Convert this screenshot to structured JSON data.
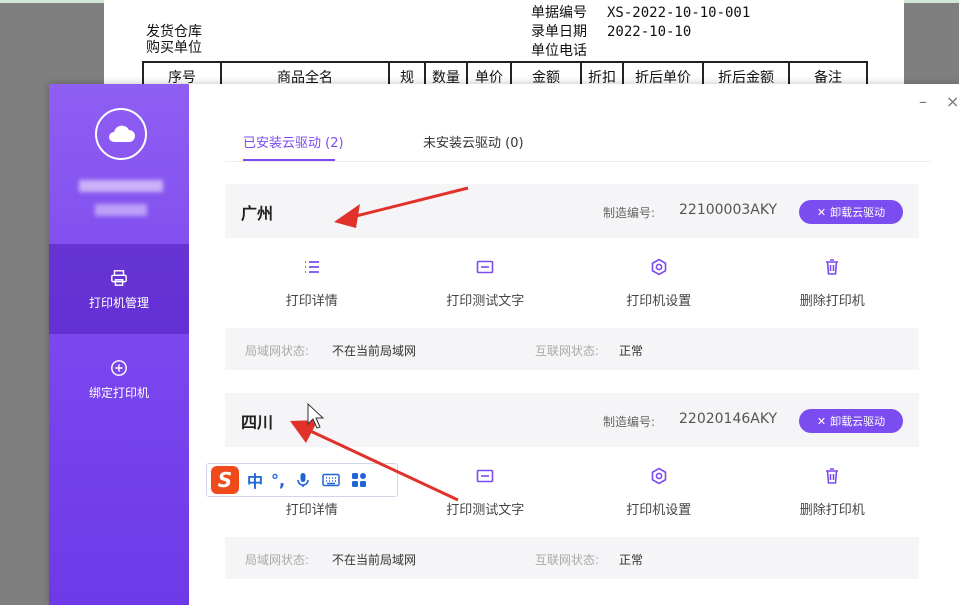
{
  "background_doc": {
    "warehouse_label": "发货仓库",
    "buyer_label": "购买单位",
    "doc_no_label": "单据编号",
    "doc_no_value": "XS-2022-10-10-001",
    "date_label": "录单日期",
    "date_value": "2022-10-10",
    "phone_label": "单位电话",
    "table_headers": [
      "序号",
      "商品全名",
      "规",
      "数量",
      "单价",
      "金额",
      "折扣",
      "折后单价",
      "折后金额",
      "备注"
    ]
  },
  "sidebar": {
    "items": [
      {
        "label": "打印机管理",
        "icon": "printer-icon"
      },
      {
        "label": "绑定打印机",
        "icon": "plus-circle-icon"
      }
    ]
  },
  "window": {
    "minimize": "–",
    "close": "×"
  },
  "tabs": [
    {
      "label": "已安装云驱动 (2)"
    },
    {
      "label": "未安装云驱动 (0)"
    }
  ],
  "printers": [
    {
      "name": "广州",
      "serial_label": "制造编号:",
      "serial": "22100003AKY",
      "uninstall_label": "卸载云驱动",
      "actions": [
        "打印详情",
        "打印测试文字",
        "打印机设置",
        "删除打印机"
      ],
      "lan_label": "局域网状态:",
      "lan_value": "不在当前局域网",
      "net_label": "互联网状态:",
      "net_value": "正常"
    },
    {
      "name": "四川",
      "serial_label": "制造编号:",
      "serial": "22020146AKY",
      "uninstall_label": "卸载云驱动",
      "actions": [
        "打印详情",
        "打印测试文字",
        "打印机设置",
        "删除打印机"
      ],
      "lan_label": "局域网状态:",
      "lan_value": "不在当前局域网",
      "net_label": "互联网状态:",
      "net_value": "正常"
    }
  ],
  "ime": {
    "logo": "S",
    "mode": "中",
    "punct": "°,"
  },
  "colors": {
    "accent": "#7b4df0",
    "arrow": "#e0322b",
    "ime_blue": "#2065d6"
  }
}
